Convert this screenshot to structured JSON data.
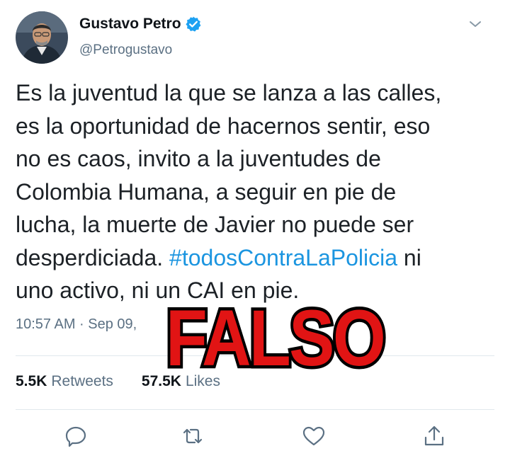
{
  "tweet": {
    "author_name": "Gustavo Petro",
    "handle": "@Petrogustavo",
    "text_before": "Es la juventud la que se lanza a las calles,\nes la oportunidad de hacernos sentir, eso\nno es caos, invito a la juventudes de\nColombia Humana, a seguir en pie de\nlucha, la muerte de Javier no puede ser\ndesperdiciada. ",
    "hashtag": "#todosContraLaPolicia",
    "text_after": " ni\nuno activo, ni un CAI en pie.",
    "timestamp": "10:57 AM · Sep 09, ",
    "retweets_count": "5.5K",
    "retweets_label": "Retweets",
    "likes_count": "57.5K",
    "likes_label": "Likes"
  },
  "overlay": {
    "stamp_text": "FALSO"
  },
  "icons": {
    "verified": "verified-badge-icon",
    "menu": "chevron-down-icon",
    "reply": "reply-icon",
    "retweet": "retweet-icon",
    "like": "heart-icon",
    "share": "share-icon"
  },
  "colors": {
    "verified": "#1da1f2",
    "hashtag": "#1b95e0",
    "stamp": "#e11414",
    "muted": "#5b7083"
  }
}
